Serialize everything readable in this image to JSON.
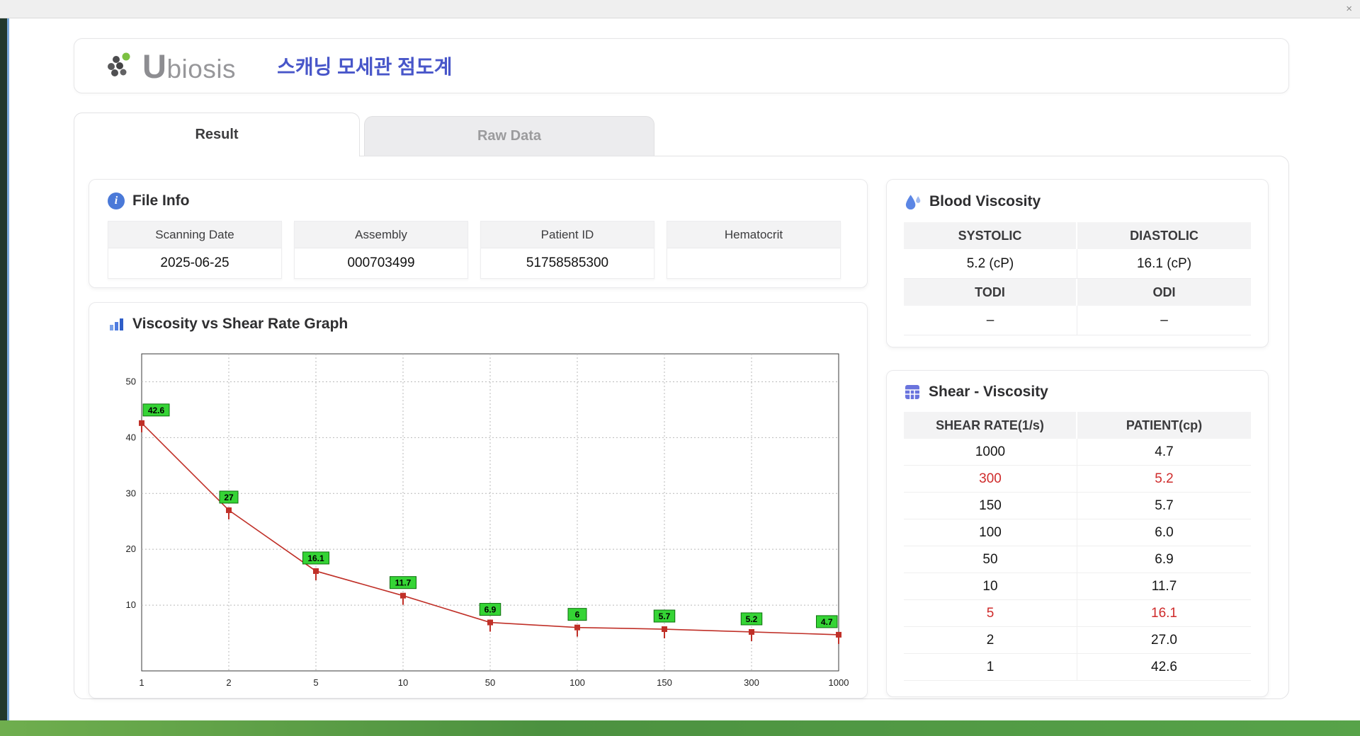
{
  "window": {
    "close_label": "×"
  },
  "header": {
    "brand": "Ubiosis",
    "app_title": "스캐닝 모세관 점도계"
  },
  "tabs": {
    "result": "Result",
    "raw_data": "Raw Data"
  },
  "file_info": {
    "title": "File Info",
    "fields": [
      {
        "label": "Scanning Date",
        "value": "2025-06-25"
      },
      {
        "label": "Assembly",
        "value": "000703499"
      },
      {
        "label": "Patient ID",
        "value": "51758585300"
      },
      {
        "label": "Hematocrit",
        "value": ""
      }
    ]
  },
  "graph": {
    "title": "Viscosity vs Shear Rate Graph"
  },
  "blood_viscosity": {
    "title": "Blood Viscosity",
    "systolic_label": "SYSTOLIC",
    "systolic_value": "5.2 (cP)",
    "diastolic_label": "DIASTOLIC",
    "diastolic_value": "16.1 (cP)",
    "todi_label": "TODI",
    "todi_value": "–",
    "odi_label": "ODI",
    "odi_value": "–"
  },
  "shear_viscosity": {
    "title": "Shear - Viscosity",
    "columns": [
      "SHEAR RATE(1/s)",
      "PATIENT(cp)"
    ],
    "rows": [
      {
        "shear": "1000",
        "patient": "4.7",
        "highlight": false
      },
      {
        "shear": "300",
        "patient": "5.2",
        "highlight": true
      },
      {
        "shear": "150",
        "patient": "5.7",
        "highlight": false
      },
      {
        "shear": "100",
        "patient": "6.0",
        "highlight": false
      },
      {
        "shear": "50",
        "patient": "6.9",
        "highlight": false
      },
      {
        "shear": "10",
        "patient": "11.7",
        "highlight": false
      },
      {
        "shear": "5",
        "patient": "16.1",
        "highlight": true
      },
      {
        "shear": "2",
        "patient": "27.0",
        "highlight": false
      },
      {
        "shear": "1",
        "patient": "42.6",
        "highlight": false
      }
    ]
  },
  "chart_data": {
    "type": "line",
    "title": "",
    "xlabel": "",
    "ylabel": "",
    "x": [
      1,
      2,
      5,
      10,
      50,
      100,
      150,
      300,
      1000
    ],
    "values": [
      42.6,
      27,
      16.1,
      11.7,
      6.9,
      6,
      5.7,
      5.2,
      4.7
    ],
    "point_labels": [
      "42.6",
      "27",
      "16.1",
      "11.7",
      "6.9",
      "6",
      "5.7",
      "5.2",
      "4.7"
    ],
    "x_ticks": [
      "1",
      "2",
      "5",
      "10",
      "50",
      "100",
      "150",
      "300",
      "1000"
    ],
    "x_scale": "categorical-equal-spacing",
    "y_ticks": [
      10,
      20,
      30,
      40,
      50
    ],
    "ylim": [
      0,
      55
    ],
    "grid": true,
    "legend": false,
    "line_color": "#c03028",
    "marker_color": "#c03028",
    "label_bg_color": "#35d435",
    "label_border_color": "#0d6e0d"
  },
  "colors": {
    "app_title_blue": "#4856c9",
    "icon_blue": "#4a79d8",
    "highlight_red": "#cf2b2b",
    "tab_active_text": "#3c3c3e"
  }
}
